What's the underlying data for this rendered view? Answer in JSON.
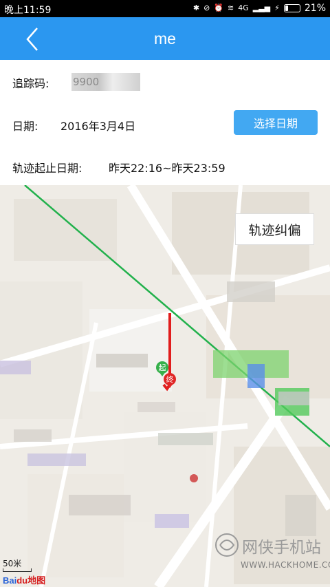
{
  "status_bar": {
    "time": "晚上11:59",
    "network_label": "4G",
    "battery_text": "21%",
    "battery_level": 0.21
  },
  "app_bar": {
    "title": "me",
    "back_icon": "chevron-left-icon"
  },
  "info": {
    "trace_code_label": "追踪码:",
    "trace_code_value": "9900",
    "date_label": "日期:",
    "date_value": "2016年3月4日",
    "select_date_button": "选择日期",
    "range_label": "轨迹起止日期:",
    "range_value": "昨天22:16~昨天23:59"
  },
  "map": {
    "correct_button": "轨迹纠偏",
    "start_marker": "起",
    "end_marker": "终",
    "scale_label": "50米",
    "logo_text_b": "Bai",
    "logo_text_d": "du地图",
    "route_color": "#e11d1d",
    "road_highlight_color": "#22b14c"
  },
  "watermark": {
    "title": "网侠手机站",
    "url": "WWW.HACKHOME.COM"
  }
}
